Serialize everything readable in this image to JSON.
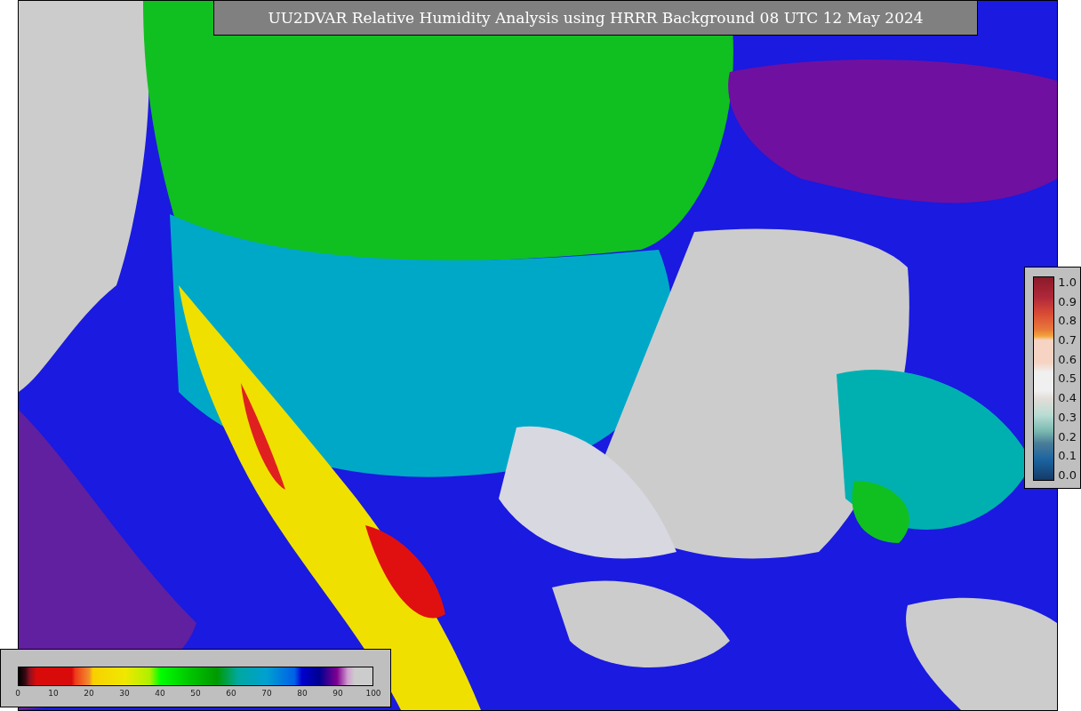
{
  "title": "UU2DVAR Relative Humidity Analysis using HRRR Background 08 UTC 12 May 2024",
  "ob_scale": {
    "ticks": [
      "1.0",
      "0.9",
      "0.8",
      "0.7",
      "0.6",
      "0.5",
      "0.4",
      "0.3",
      "0.2",
      "0.1",
      "0.0"
    ]
  },
  "humidity_scale": {
    "ticks": [
      "0",
      "10",
      "20",
      "30",
      "40",
      "50",
      "60",
      "70",
      "80",
      "90",
      "100"
    ]
  }
}
